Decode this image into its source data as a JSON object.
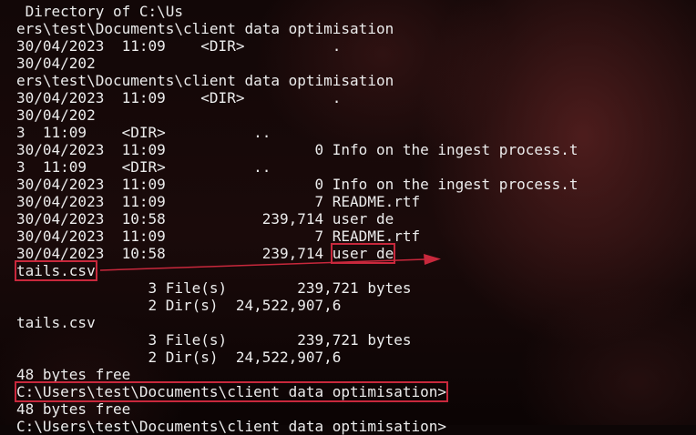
{
  "terminal": {
    "lines": [
      " Directory of C:\\Us",
      "ers\\test\\Documents\\client data optimisation",
      "30/04/2023  11:09    <DIR>          .",
      "30/04/202",
      "ers\\test\\Documents\\client data optimisation",
      "30/04/2023  11:09    <DIR>          .",
      "30/04/202",
      "3  11:09    <DIR>          ..",
      "30/04/2023  11:09                 0 Info on the ingest process.t",
      "3  11:09    <DIR>          ..",
      "30/04/2023  11:09                 0 Info on the ingest process.t",
      "30/04/2023  11:09                 7 README.rtf",
      "30/04/2023  10:58           239,714 user de",
      "30/04/2023  11:09                 7 README.rtf",
      "30/04/2023  10:58           239,714 ",
      "tails.csv",
      "               3 File(s)        239,721 bytes",
      "               2 Dir(s)  24,522,907,6",
      "tails.csv",
      "               3 File(s)        239,721 bytes",
      "               2 Dir(s)  24,522,907,6",
      "48 bytes free",
      "C:\\Users\\test\\Documents\\client data optimisation>",
      "48 bytes free",
      "C:\\Users\\test\\Documents\\client data optimisation>"
    ],
    "highlighted_fragment": "user de",
    "colors": {
      "text": "#ececec",
      "highlight_box": "#c8283c",
      "background": "#120707"
    }
  }
}
